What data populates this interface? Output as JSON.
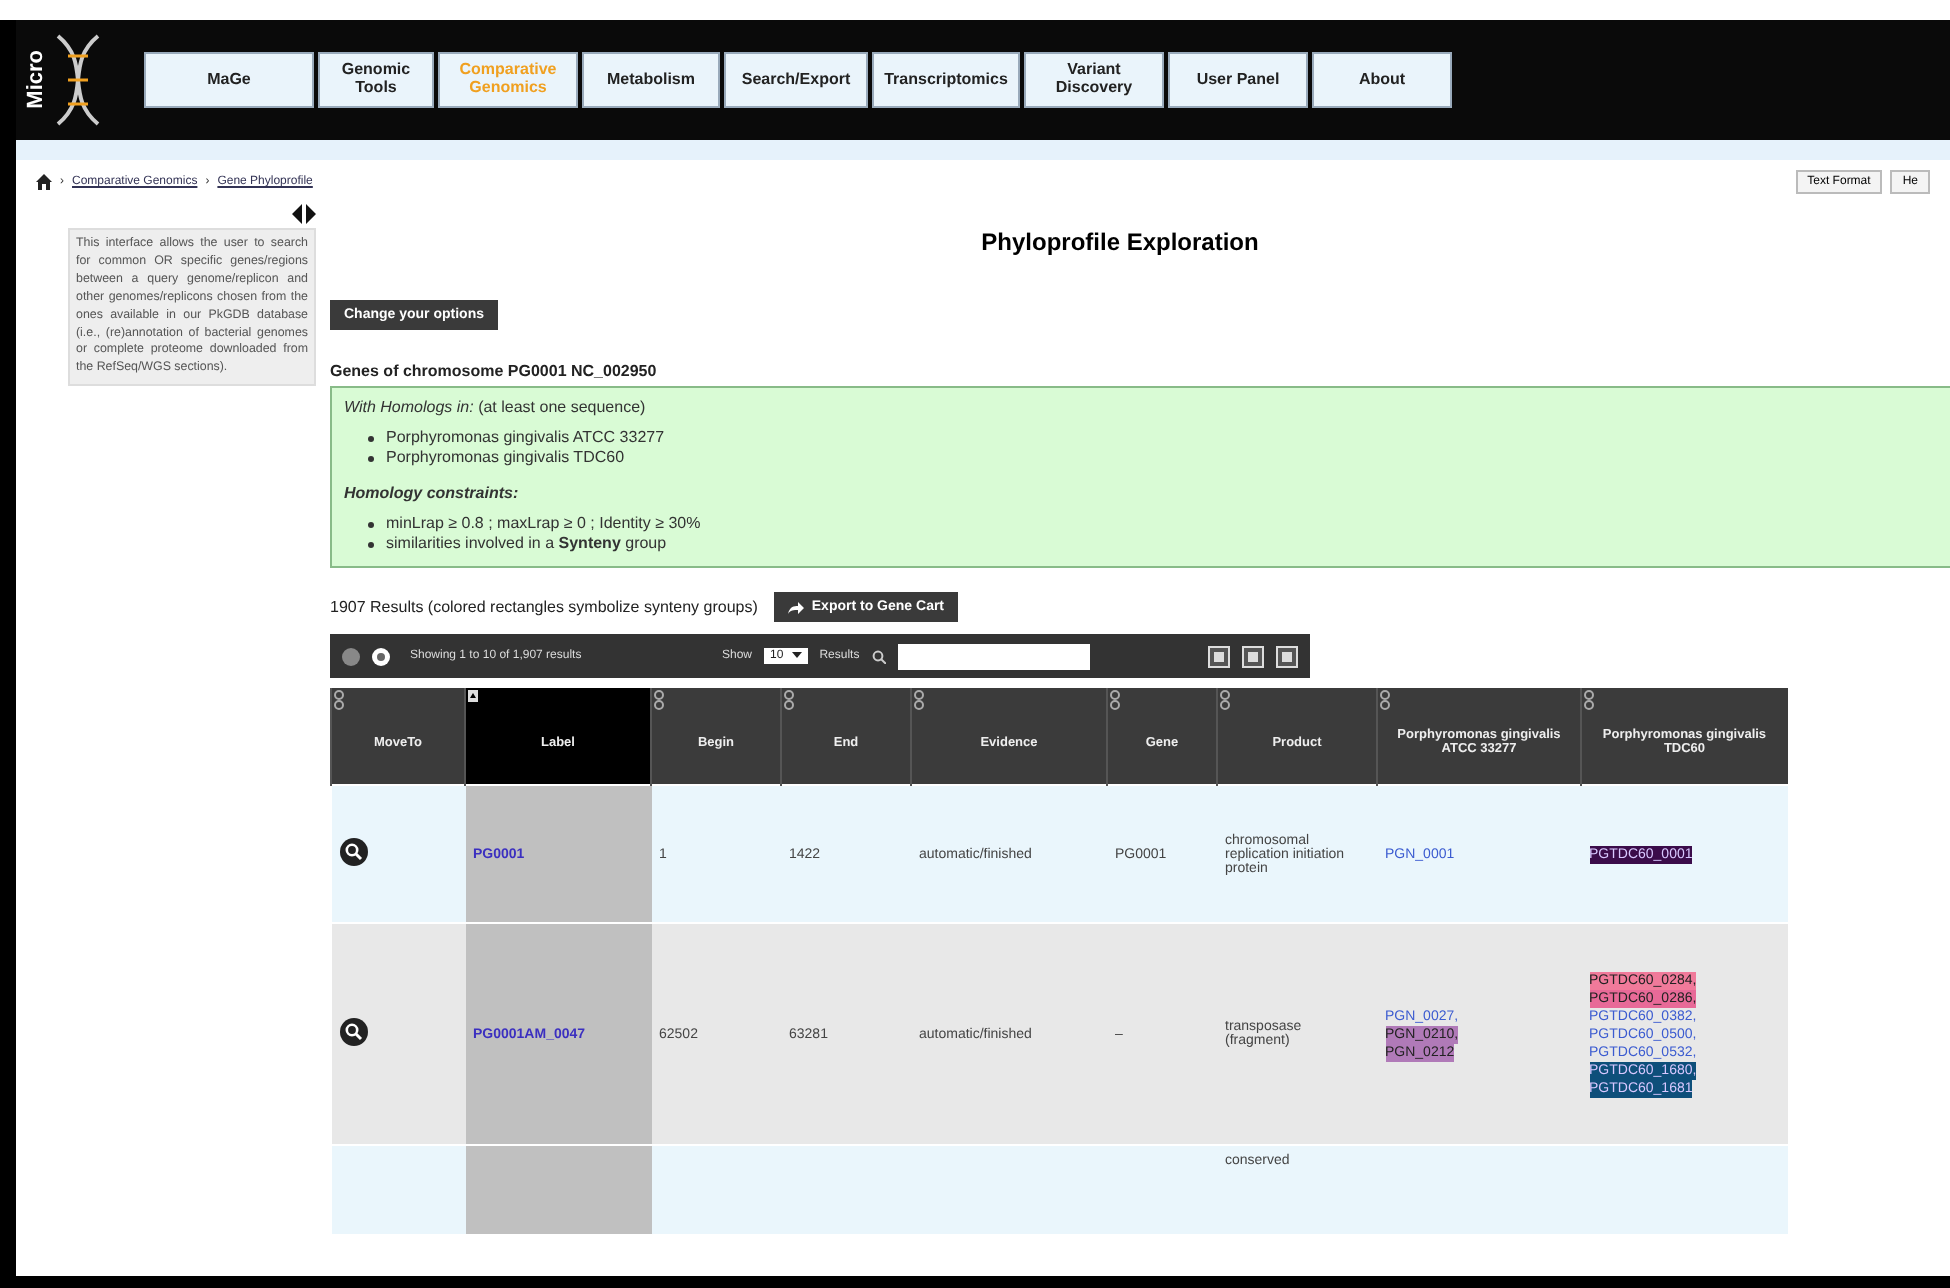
{
  "logo": {
    "text": "Micro"
  },
  "nav": [
    {
      "label": "MaGe",
      "selected": false
    },
    {
      "label": "Genomic Tools",
      "selected": false
    },
    {
      "label": "Comparative Genomics",
      "selected": true
    },
    {
      "label": "Metabolism",
      "selected": false
    },
    {
      "label": "Search/Export",
      "selected": false
    },
    {
      "label": "Transcriptomics",
      "selected": false
    },
    {
      "label": "Variant Discovery",
      "selected": false
    },
    {
      "label": "User Panel",
      "selected": false
    },
    {
      "label": "About",
      "selected": false
    }
  ],
  "breadcrumb": [
    {
      "separator": "›",
      "label": "Comparative Genomics"
    },
    {
      "separator": "›",
      "label": "Gene Phyloprofile"
    }
  ],
  "top_buttons": [
    "Text Format",
    "He"
  ],
  "sidebar": {
    "text": "This interface allows the user to search for common OR specific genes/regions between a query genome/replicon and other genomes/replicons chosen from the ones available in our PkGDB database (i.e., (re)annotation of bacterial genomes or complete proteome downloaded from the RefSeq/WGS sections)."
  },
  "title": "Phyloprofile Exploration",
  "options_button": "Change your options",
  "subtitle": "Genes of chromosome PG0001 NC_002950",
  "criteria": {
    "homologs_heading": "*With Homologs in:* (at least one sequence)",
    "organisms": [
      "Porphyromonas gingivalis ATCC 33277",
      "Porphyromonas gingivalis TDC60"
    ],
    "constraints_heading": "Homology constraints:",
    "constraints": [
      "minLrap ≥ 0.8 ; maxLrap ≥ 0 ; Identity ≥ 30%",
      "similarities involved in a **Synteny** group"
    ]
  },
  "results": {
    "summary": "1907 Results (colored rectangles symbolize synteny groups)",
    "export_button": "Export to Gene Cart"
  },
  "toolbar": {
    "info": "Showing 1 to 10 of 1,907 results",
    "show_label": "Show",
    "page_size": "10",
    "results_label": "Results"
  },
  "table": {
    "columns": [
      {
        "label": "MoveTo",
        "sorted": false
      },
      {
        "label": "Label",
        "sorted": true
      },
      {
        "label": "Begin",
        "sorted": false
      },
      {
        "label": "End",
        "sorted": false
      },
      {
        "label": "Evidence",
        "sorted": false
      },
      {
        "label": "Gene",
        "sorted": false
      },
      {
        "label": "Product",
        "sorted": false
      },
      {
        "label": "Porphyromonas gingivalis ATCC 33277",
        "sorted": false
      },
      {
        "label": "Porphyromonas gingivalis TDC60",
        "sorted": false
      }
    ],
    "rows": [
      {
        "label": "PG0001",
        "begin": "1",
        "end": "1422",
        "evidence": "automatic/finished",
        "gene": "PG0001",
        "product": "chromosomal replication initiation protein",
        "atcc": [
          {
            "text": "PGN_0001"
          }
        ],
        "tdc60": [
          {
            "text": "PGTDC60_0001",
            "color": "#3b0c4a"
          }
        ]
      },
      {
        "label": "PG0001AM_0047",
        "begin": "62502",
        "end": "63281",
        "evidence": "automatic/finished",
        "gene": "–",
        "product": "transposase (fragment)",
        "atcc": [
          {
            "text": "PGN_0027,"
          },
          {
            "text": "PGN_0210,",
            "color": "#b07ab8"
          },
          {
            "text": "PGN_0212",
            "color": "#b07ab8"
          }
        ],
        "tdc60": [
          {
            "text": "PGTDC60_0284,",
            "color": "#f07a9a"
          },
          {
            "text": "PGTDC60_0286,",
            "color": "#e86a98"
          },
          {
            "text": "PGTDC60_0382,"
          },
          {
            "text": "PGTDC60_0500,"
          },
          {
            "text": "PGTDC60_0532,"
          },
          {
            "text": "PGTDC60_1680,",
            "color": "#0e4f7a"
          },
          {
            "text": "PGTDC60_1681",
            "color": "#0e4f7a"
          }
        ]
      },
      {
        "label": "",
        "begin": "",
        "end": "",
        "evidence": "",
        "gene": "",
        "product": "conserved",
        "atcc": [],
        "tdc60": []
      }
    ]
  }
}
